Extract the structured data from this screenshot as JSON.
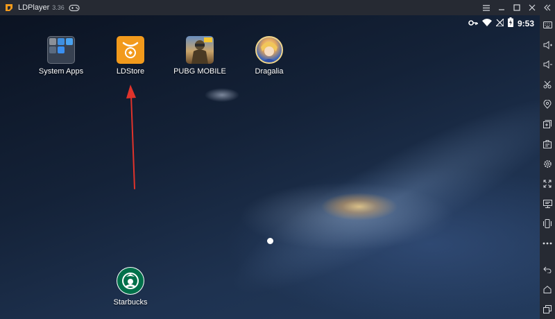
{
  "window": {
    "title": "LDPlayer",
    "version": "3.36"
  },
  "statusbar": {
    "time": "9:53"
  },
  "desktop": {
    "apps": [
      {
        "label": "System Apps",
        "icon": "folder-icon"
      },
      {
        "label": "LDStore",
        "icon": "ldstore-icon"
      },
      {
        "label": "PUBG MOBILE",
        "icon": "pubg-mobile-icon"
      },
      {
        "label": "Dragalia",
        "icon": "dragalia-icon"
      },
      {
        "label": "Starbucks",
        "icon": "starbucks-icon"
      }
    ]
  },
  "sidebar": {
    "tools": [
      "keyboard-mapping-icon",
      "volume-up-icon",
      "volume-down-icon",
      "scissors-icon",
      "location-icon",
      "add-apk-icon",
      "screenshot-icon",
      "settings-icon",
      "fullscreen-icon",
      "multi-instance-icon",
      "shake-icon",
      "more-icon",
      "back-icon",
      "home-icon",
      "recent-apps-icon"
    ]
  },
  "colors": {
    "chrome": "#262a33",
    "ldstore_orange": "#f29a1c",
    "annotation_arrow": "#e0332b",
    "starbucks_green": "#00704a"
  }
}
